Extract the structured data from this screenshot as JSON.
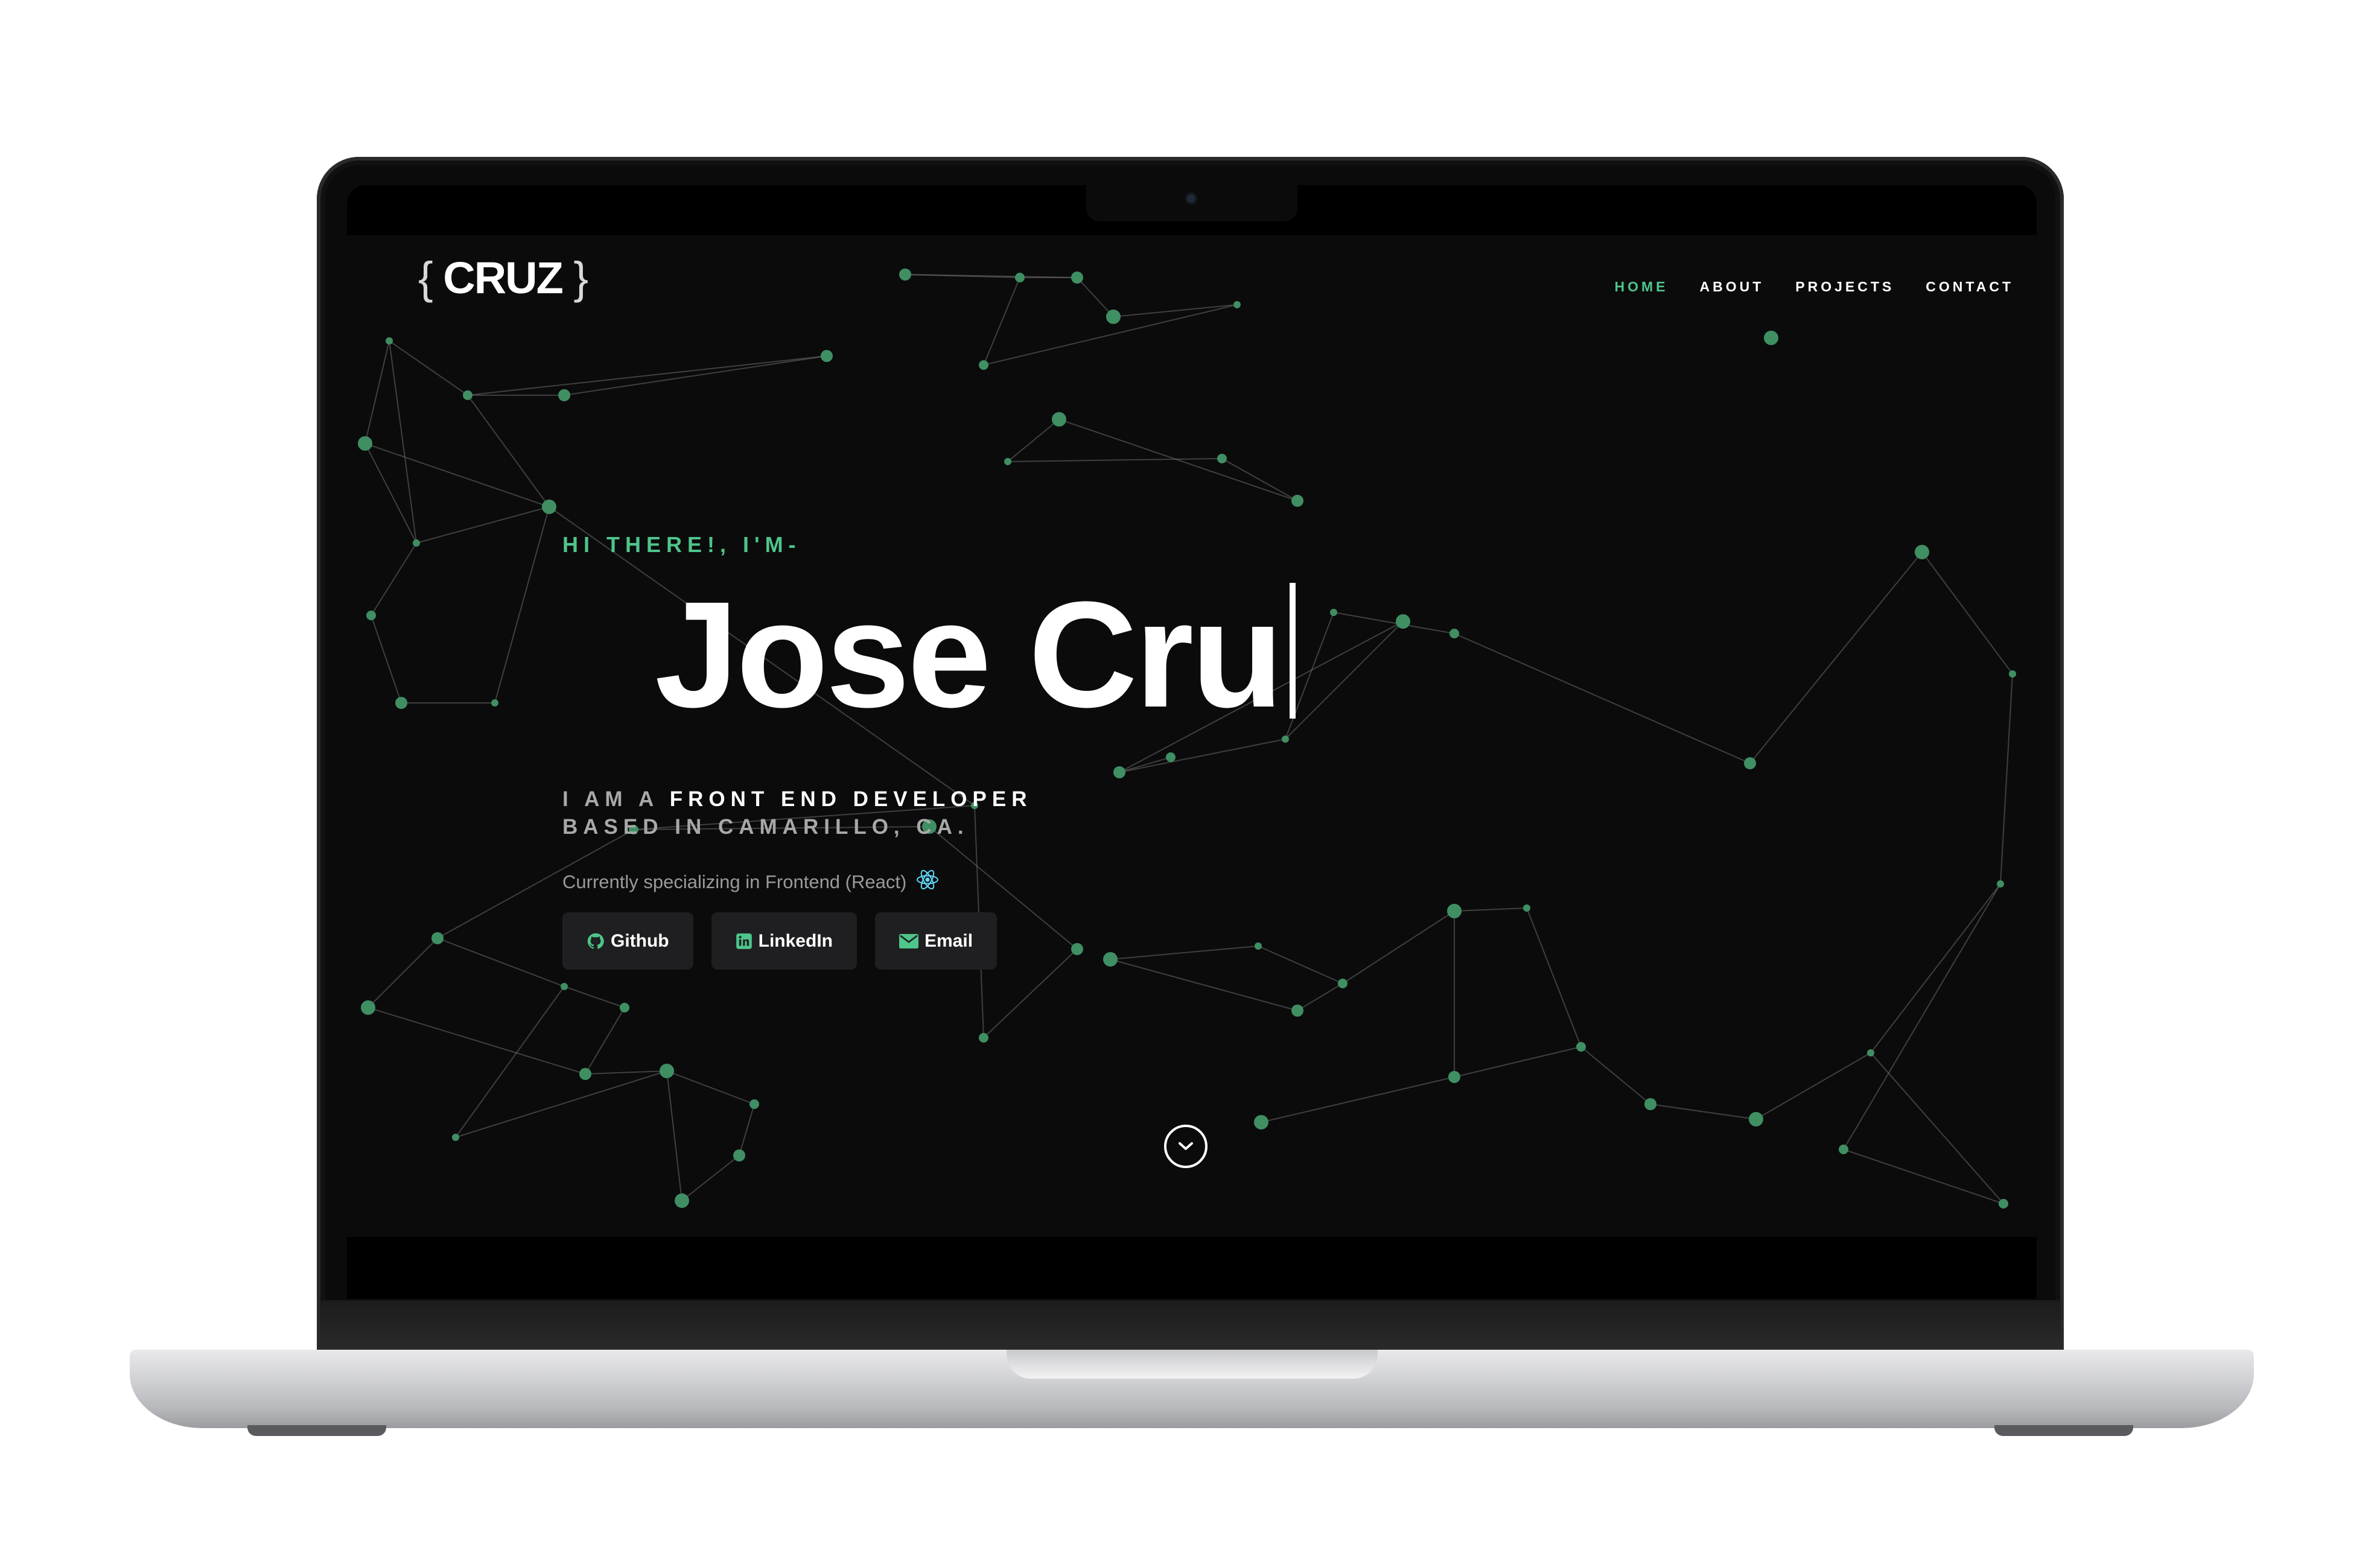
{
  "logo": {
    "brace_open": "{",
    "text": "CRUZ",
    "brace_close": "}"
  },
  "nav": {
    "items": [
      "HOME",
      "ABOUT",
      "PROJECTS",
      "CONTACT"
    ],
    "active": "HOME"
  },
  "hero": {
    "greeting": "HI THERE!, I'M-",
    "name": "Jose Cru",
    "role_prefix": "I AM A ",
    "role_title": "FRONT END DEVELOPER",
    "role_line2": "BASED IN CAMARILLO, CA.",
    "specializing": "Currently specializing in Frontend (React)"
  },
  "buttons": {
    "github": "Github",
    "linkedin": "LinkedIn",
    "email": "Email"
  },
  "icons": {
    "logo_brand": "braces-logo",
    "github": "github-icon",
    "linkedin": "linkedin-icon",
    "email": "envelope-icon",
    "react": "react-icon",
    "scroll": "chevron-down-circle-icon"
  },
  "colors": {
    "accent": "#4ec58a",
    "background": "#0b0b0c",
    "button_bg": "#1f1f21",
    "text": "#ffffff",
    "muted": "#9a9a9a"
  }
}
